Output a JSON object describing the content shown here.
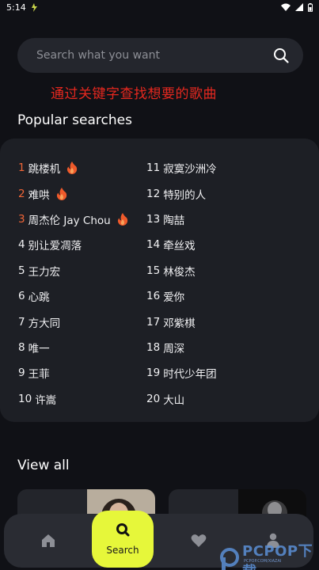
{
  "status_bar": {
    "time": "5:14"
  },
  "search": {
    "placeholder": "Search what you want"
  },
  "caption": "通过关键字查找想要的歌曲",
  "popular": {
    "title": "Popular searches",
    "left": [
      {
        "rank": "1",
        "label": "跳楼机",
        "hot": true
      },
      {
        "rank": "2",
        "label": "难哄",
        "hot": true
      },
      {
        "rank": "3",
        "label": "周杰伦 Jay Chou",
        "hot": true
      },
      {
        "rank": "4",
        "label": "别让爱凋落",
        "hot": false
      },
      {
        "rank": "5",
        "label": "王力宏",
        "hot": false
      },
      {
        "rank": "6",
        "label": "心跳",
        "hot": false
      },
      {
        "rank": "7",
        "label": "方大同",
        "hot": false
      },
      {
        "rank": "8",
        "label": "唯一",
        "hot": false
      },
      {
        "rank": "9",
        "label": "王菲",
        "hot": false
      },
      {
        "rank": "10",
        "label": "许嵩",
        "hot": false
      }
    ],
    "right": [
      {
        "rank": "11",
        "label": "寂寞沙洲冷",
        "hot": false
      },
      {
        "rank": "12",
        "label": "特别的人",
        "hot": false
      },
      {
        "rank": "13",
        "label": "陶喆",
        "hot": false
      },
      {
        "rank": "14",
        "label": "牵丝戏",
        "hot": false
      },
      {
        "rank": "15",
        "label": "林俊杰",
        "hot": false
      },
      {
        "rank": "16",
        "label": "爱你",
        "hot": false
      },
      {
        "rank": "17",
        "label": "邓紫棋",
        "hot": false
      },
      {
        "rank": "18",
        "label": "周深",
        "hot": false
      },
      {
        "rank": "19",
        "label": "时代少年团",
        "hot": false
      },
      {
        "rank": "20",
        "label": "大山",
        "hot": false
      }
    ]
  },
  "view_all": {
    "title": "View all"
  },
  "nav": {
    "search_label": "Search"
  },
  "watermark": {
    "text": "PCPOP下载",
    "sub": "PCPOP.COM/XIAZAI"
  },
  "colors": {
    "accent": "#e6f73a",
    "hot_rank": "#ef6537",
    "caption": "#e5281f",
    "background": "#101116",
    "card": "#1d1f25"
  }
}
